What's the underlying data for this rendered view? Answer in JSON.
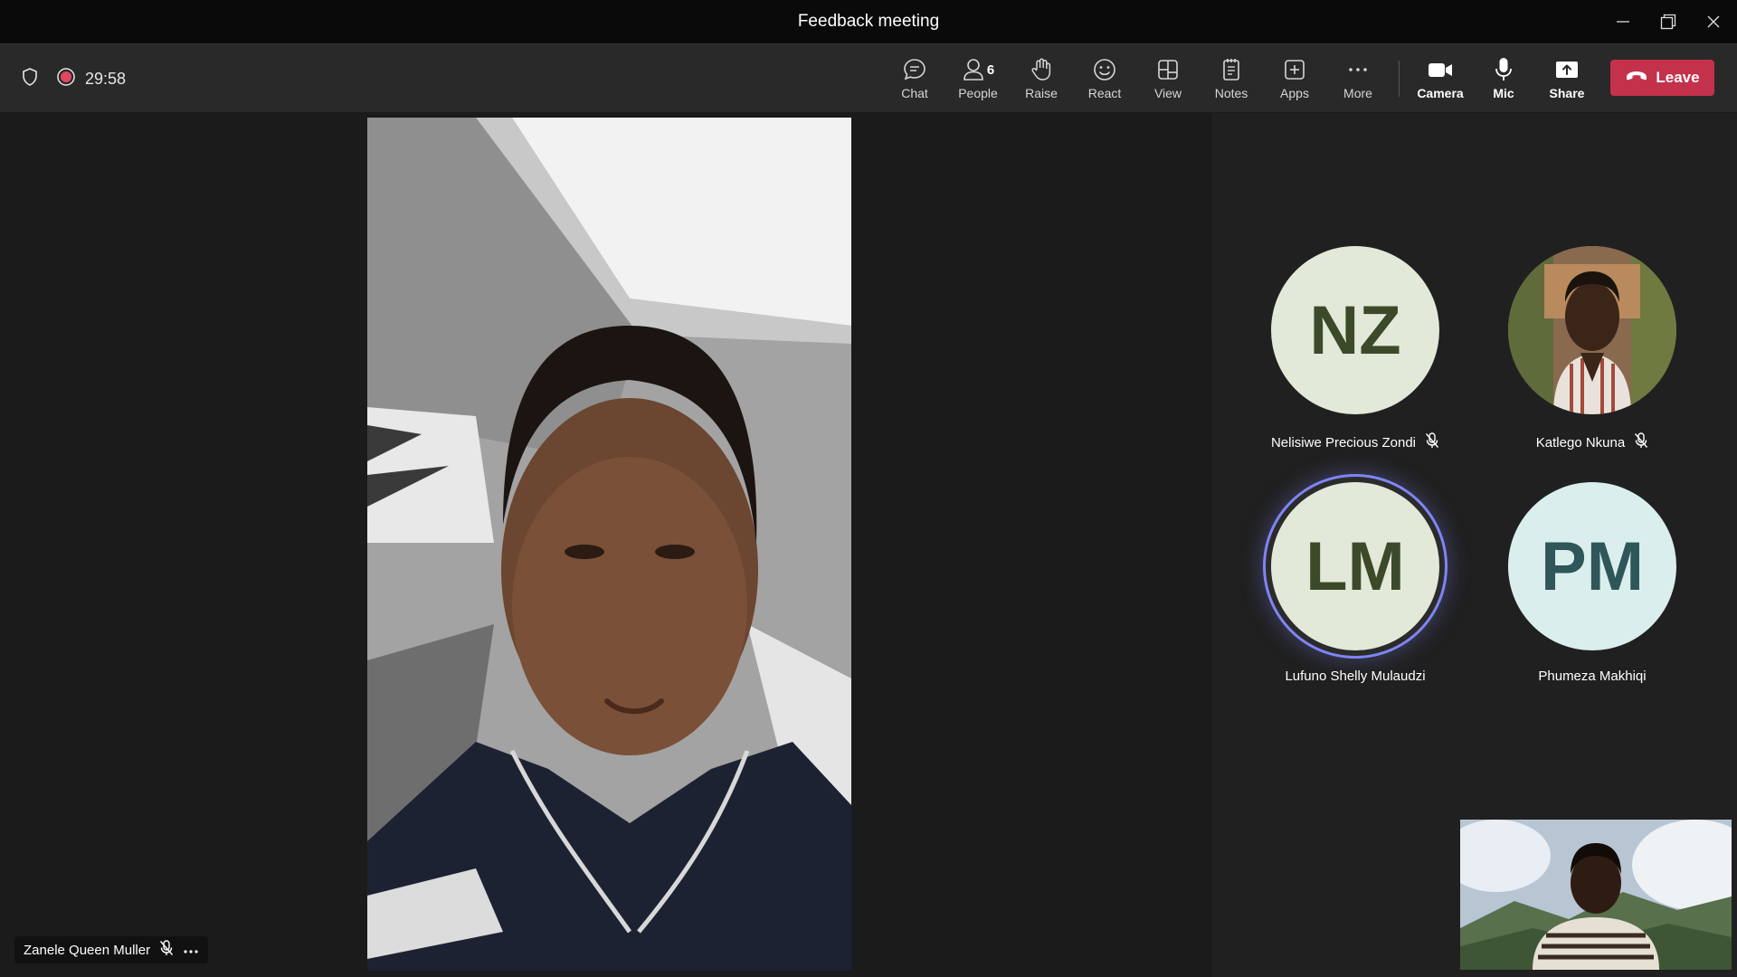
{
  "window": {
    "title": "Feedback meeting"
  },
  "toolbar": {
    "timer": "29:58",
    "chat": "Chat",
    "people": "People",
    "people_count": "6",
    "raise": "Raise",
    "react": "React",
    "view": "View",
    "notes": "Notes",
    "apps": "Apps",
    "more": "More",
    "camera": "Camera",
    "mic": "Mic",
    "share": "Share",
    "leave": "Leave"
  },
  "main_video": {
    "participant": "Zanele Queen Muller",
    "muted": true
  },
  "participants": [
    {
      "initials": "NZ",
      "name": "Nelisiwe Precious Zondi",
      "muted": true,
      "avatar_color": "#e3e9d8"
    },
    {
      "initials": "",
      "name": "Katlego Nkuna",
      "muted": true,
      "avatar_color": "#a8866a"
    },
    {
      "initials": "LM",
      "name": "Lufuno Shelly Mulaudzi",
      "muted": false,
      "speaking": true,
      "avatar_color": "#e3e9d8"
    },
    {
      "initials": "PM",
      "name": "Phumeza Makhiqi",
      "muted": false,
      "avatar_color": "#dbeeee"
    }
  ],
  "colors": {
    "leave": "#c4314b",
    "speaking_ring": "#7f85f5",
    "record": "#e3475f"
  }
}
